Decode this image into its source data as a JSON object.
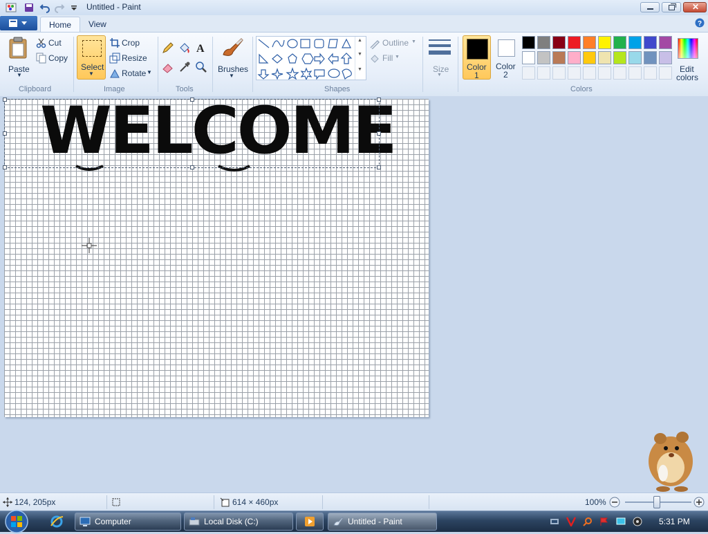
{
  "window": {
    "title": "Untitled - Paint"
  },
  "tabs": [
    {
      "label": "Home"
    },
    {
      "label": "View"
    }
  ],
  "ribbon": {
    "clipboard": {
      "group_label": "Clipboard",
      "paste_label": "Paste",
      "cut_label": "Cut",
      "copy_label": "Copy"
    },
    "image": {
      "group_label": "Image",
      "select_label": "Select",
      "crop_label": "Crop",
      "resize_label": "Resize",
      "rotate_label": "Rotate"
    },
    "tools": {
      "group_label": "Tools"
    },
    "brushes": {
      "label": "Brushes"
    },
    "shapes": {
      "group_label": "Shapes",
      "outline_label": "Outline",
      "fill_label": "Fill"
    },
    "size": {
      "label": "Size"
    },
    "colors": {
      "group_label": "Colors",
      "color1_label_line1": "Color",
      "color1_label_line2": "1",
      "color2_label_line1": "Color",
      "color2_label_line2": "2",
      "edit_label_line1": "Edit",
      "edit_label_line2": "colors",
      "color1_value": "#000000",
      "color2_value": "#ffffff",
      "palette_row1": [
        "#000000",
        "#7f7f7f",
        "#880015",
        "#ed1c24",
        "#ff7f27",
        "#fff200",
        "#22b14c",
        "#00a2e8",
        "#3f48cc",
        "#a349a4"
      ],
      "palette_row2": [
        "#ffffff",
        "#c3c3c3",
        "#b97a57",
        "#ffaec9",
        "#ffc90e",
        "#efe4b0",
        "#b5e61d",
        "#99d9ea",
        "#7092be",
        "#c8bfe7"
      ]
    }
  },
  "canvas": {
    "text": "WELCOME"
  },
  "status": {
    "cursor_pos": "124, 205px",
    "image_size": "614 × 460px",
    "zoom": "100%"
  },
  "taskbar": {
    "items": [
      {
        "label": "Computer"
      },
      {
        "label": "Local Disk (C:)"
      },
      {
        "label": ""
      },
      {
        "label": "Untitled - Paint"
      }
    ],
    "clock": "5:31 PM"
  },
  "accent_colors": {
    "selected_button": "#ffd36b",
    "ribbon_bg": "#e6eef9",
    "workspace_bg": "#c9d8ec"
  }
}
